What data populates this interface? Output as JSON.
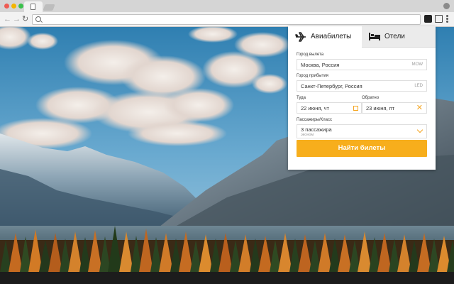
{
  "browser": {
    "window_dots": [
      "#ee5b53",
      "#f4b400",
      "#3ac14c"
    ]
  },
  "widget": {
    "tabs": {
      "flights": "Авиабилеты",
      "hotels": "Отели"
    },
    "origin": {
      "label": "Город вылета",
      "value": "Москва, Россия",
      "code": "MOW"
    },
    "destination": {
      "label": "Город прибытия",
      "value": "Санкт-Петербург, Россия",
      "code": "LED"
    },
    "depart": {
      "label": "Туда",
      "value": "22 июня, чт"
    },
    "return": {
      "label": "Обратно",
      "value": "23 июня, пт"
    },
    "passengers": {
      "label": "Пассажиры/Класс",
      "value": "3 пассажира",
      "class": "эконом"
    },
    "submit_label": "Найти билеты",
    "accent_color": "#f7ae1c"
  }
}
